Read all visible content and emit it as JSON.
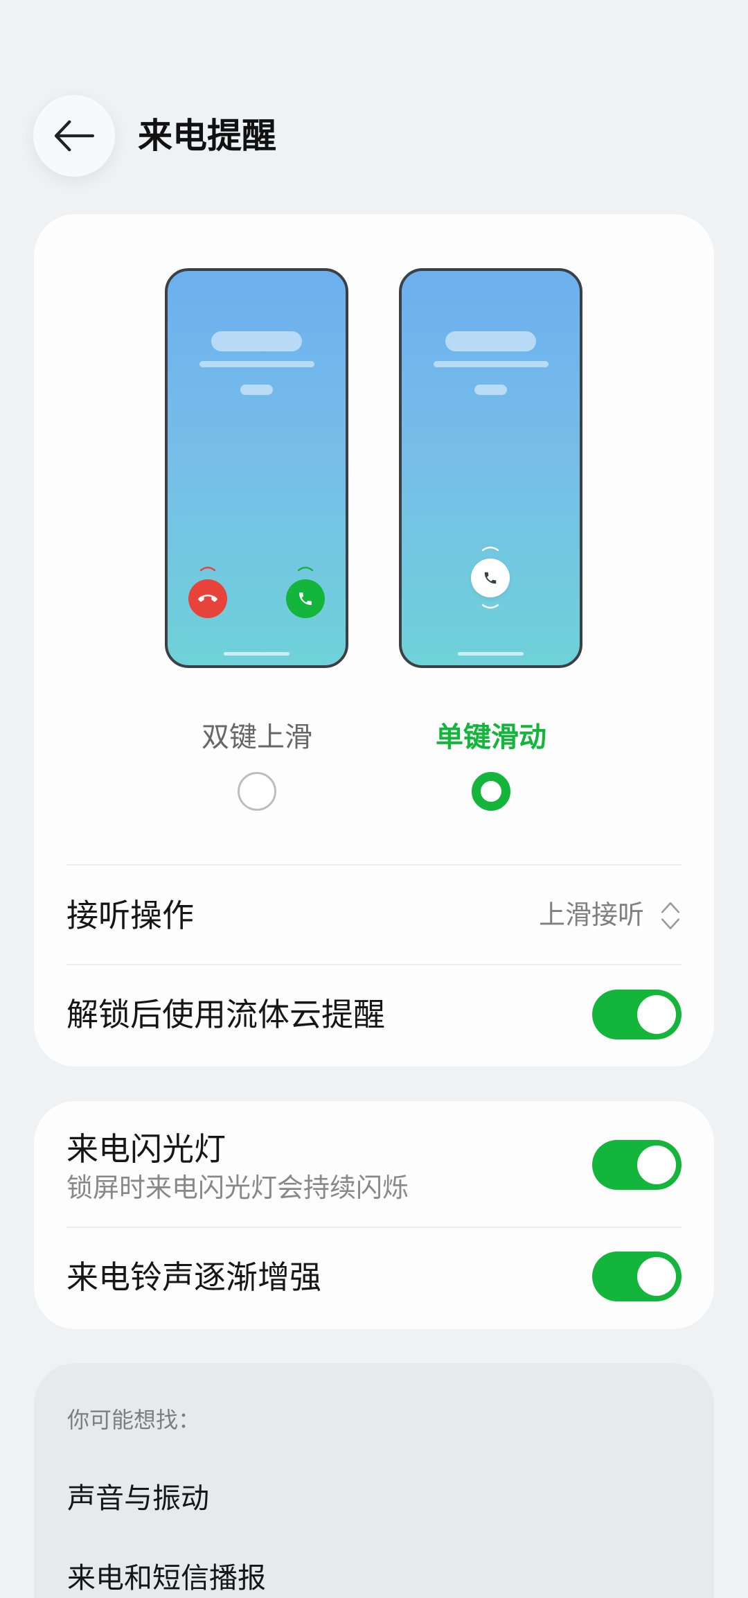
{
  "header": {
    "back_icon": "arrow-left-icon",
    "title": "来电提醒"
  },
  "style_card": {
    "options": [
      {
        "label": "双键上滑",
        "selected": false,
        "decline_icon": "call-end-icon",
        "answer_icon": "call-icon"
      },
      {
        "label": "单键滑动",
        "selected": true,
        "slide_icon": "call-icon"
      }
    ],
    "answer_action": {
      "label": "接听操作",
      "value": "上滑接听",
      "icon": "chevron-up-down-icon"
    },
    "fluid_cloud_reminder": {
      "label": "解锁后使用流体云提醒",
      "enabled": true
    }
  },
  "alert_card": {
    "call_flash": {
      "label": "来电闪光灯",
      "description": "锁屏时来电闪光灯会持续闪烁",
      "enabled": true
    },
    "ringtone_fade_in": {
      "label": "来电铃声逐渐增强",
      "enabled": true
    }
  },
  "suggestions_card": {
    "heading": "你可能想找：",
    "items": [
      "声音与振动",
      "来电和短信播报"
    ]
  },
  "colors": {
    "accent": "#13b53b",
    "decline": "#e8433b",
    "background": "#eff1f3"
  }
}
